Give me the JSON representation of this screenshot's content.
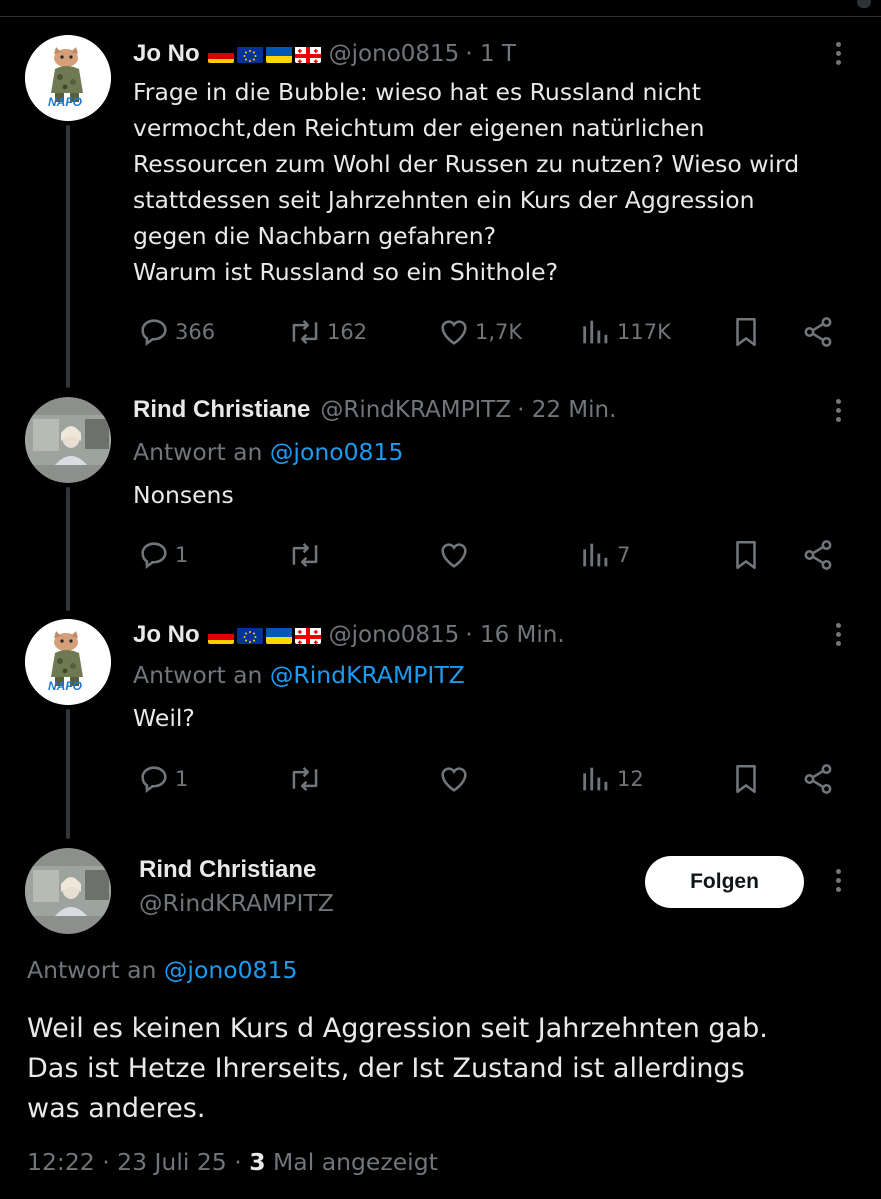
{
  "tweets": [
    {
      "name": "Jo No",
      "handle": "@jono0815",
      "time": "· 1 T",
      "lines": [
        "Frage in die Bubble: wieso hat es Russland nicht",
        "vermocht,den Reichtum der eigenen natürlichen",
        "Ressourcen zum Wohl der Russen zu nutzen? Wieso wird",
        "stattdessen seit Jahrzehnten ein Kurs der Aggression",
        "gegen die Nachbarn gefahren?",
        "Warum ist Russland so ein Shithole?"
      ],
      "replies": "366",
      "retweets": "162",
      "likes": "1,7K",
      "views": "117K"
    },
    {
      "name": "Rind Christiane",
      "handle": "@RindKRAMPITZ",
      "time": "· 22 Min.",
      "reply_prefix": "Antwort an",
      "reply_mention": "@jono0815",
      "text": "Nonsens",
      "replies": "1",
      "retweets": "",
      "likes": "",
      "views": "7"
    },
    {
      "name": "Jo No",
      "handle": "@jono0815",
      "time": "· 16 Min.",
      "reply_prefix": "Antwort an",
      "reply_mention": "@RindKRAMPITZ",
      "text": "Weil?",
      "replies": "1",
      "retweets": "",
      "likes": "",
      "views": "12"
    }
  ],
  "main": {
    "name": "Rind Christiane",
    "handle": "@RindKRAMPITZ",
    "follow_label": "Folgen",
    "reply_prefix": "Antwort an",
    "reply_mention": "@jono0815",
    "lines": [
      "Weil es keinen Kurs d Aggression seit Jahrzehnten gab.",
      "Das ist Hetze Ihrerseits, der Ist Zustand ist allerdings",
      "was anderes."
    ],
    "time": "12:22 · 23 Juli 25 ·",
    "views_count": "3",
    "views_label": "Mal angezeigt"
  },
  "avatar_badge": "NAFO",
  "icons": [
    "more-icon",
    "reply-icon",
    "retweet-icon",
    "like-icon",
    "views-icon",
    "bookmark-icon",
    "share-icon"
  ],
  "colors": {
    "background": "#000000",
    "text": "#e7e9ea",
    "muted": "#71767b",
    "link": "#1d9bf0",
    "line": "#333639"
  }
}
